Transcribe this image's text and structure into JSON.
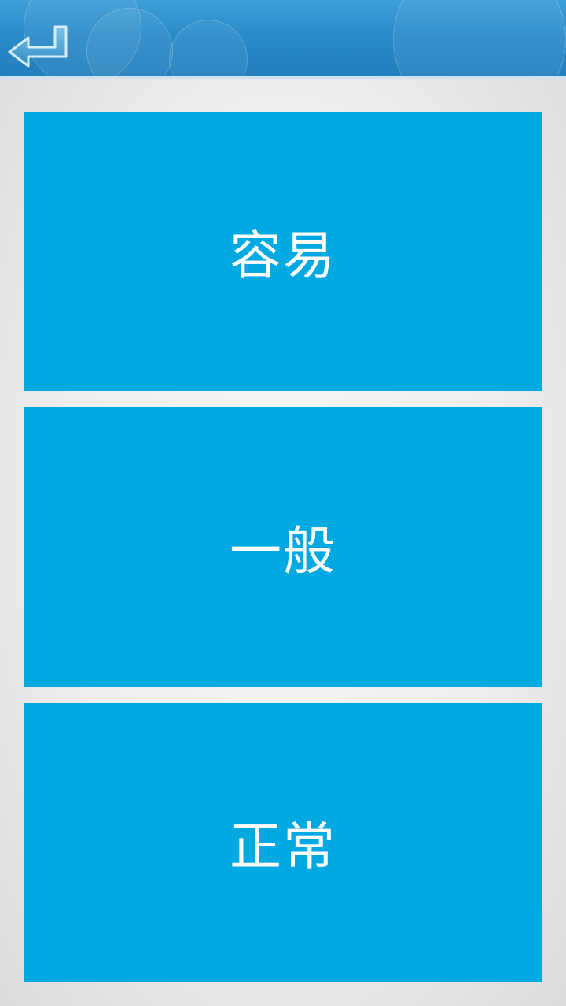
{
  "header": {
    "back_icon": "return-arrow-icon",
    "accent_color": "#2b8bc8"
  },
  "difficulty": {
    "options": [
      {
        "label": "容易"
      },
      {
        "label": "一般"
      },
      {
        "label": "正常"
      }
    ],
    "button_color": "#00a9e2"
  }
}
